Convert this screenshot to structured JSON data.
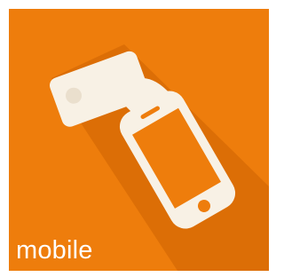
{
  "tile": {
    "label": "mobile",
    "icon": "mobile-payment-card-icon",
    "colors": {
      "background": "#ee7d0c",
      "shadow": "#d96d05",
      "icon": "#f8f1e5"
    }
  }
}
